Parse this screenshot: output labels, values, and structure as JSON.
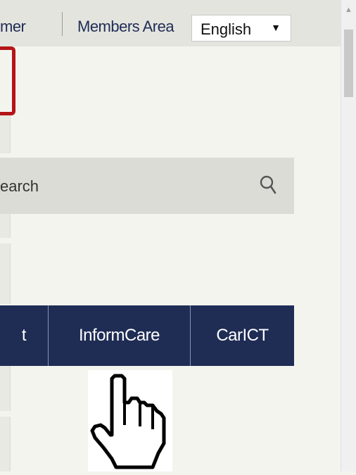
{
  "header": {
    "disclaimer_fragment": "mer",
    "members_area": "Members Area",
    "language_select": {
      "selected": "English",
      "arrow": "▼"
    }
  },
  "search": {
    "placeholder_fragment": "earch",
    "icon": "search-icon"
  },
  "nav_tabs": [
    {
      "label": "t"
    },
    {
      "label": "InformCare"
    },
    {
      "label": "CarICT"
    }
  ],
  "colors": {
    "navy": "#1f2d55",
    "highlight_red": "#b51416",
    "background": "#f4f4ef"
  },
  "cursor": {
    "icon": "hand-pointer-icon"
  },
  "scrollbar": {
    "up_arrow": "▲"
  }
}
